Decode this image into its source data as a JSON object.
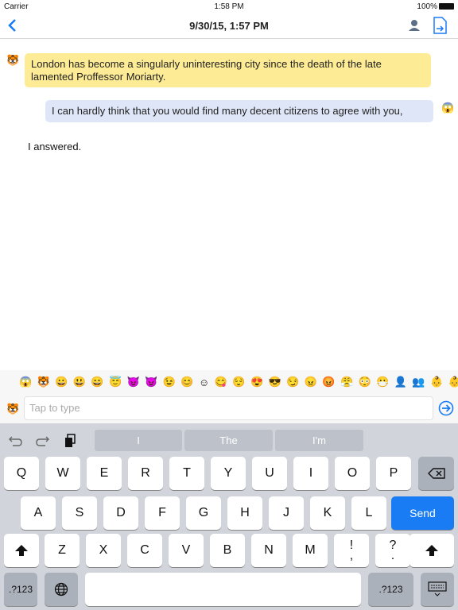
{
  "status": {
    "carrier": "Carrier",
    "time": "1:58 PM",
    "battery": "100%"
  },
  "nav": {
    "title": "9/30/15, 1:57 PM",
    "back_icon": "chevron-left",
    "icons": [
      "person-icon",
      "copy-document-icon"
    ]
  },
  "messages": [
    {
      "avatar": "🐯",
      "text": "London has become a singularly uninteresting city since the death of the late lamented Proffessor Moriarty."
    },
    {
      "avatar": "😱",
      "text": "I can hardly think that you would find many decent citizens to agree with you,"
    },
    {
      "text": "I answered."
    }
  ],
  "emoji_bar": [
    "😱",
    "🐯",
    "😀",
    "😃",
    "😄",
    "😇",
    "😈",
    "👿",
    "😉",
    "😊",
    "☺",
    "😋",
    "😌",
    "😍",
    "😎",
    "😏",
    "😠",
    "😡",
    "😤",
    "😳",
    "😷",
    "👤",
    "👥",
    "👶",
    "👶"
  ],
  "input": {
    "avatar": "🐯",
    "placeholder": "Tap to type"
  },
  "suggestions": [
    "I",
    "The",
    "I'm"
  ],
  "keyboard": {
    "row1": [
      "Q",
      "W",
      "E",
      "R",
      "T",
      "Y",
      "U",
      "I",
      "O",
      "P"
    ],
    "row2": [
      "A",
      "S",
      "D",
      "F",
      "G",
      "H",
      "J",
      "K",
      "L"
    ],
    "row3": [
      "Z",
      "X",
      "C",
      "V",
      "B",
      "N",
      "M",
      "!\n,",
      "?\n."
    ],
    "send": "Send",
    "numbers": ".?123"
  },
  "colors": {
    "accent": "#1a7cf5",
    "incoming": "#fdeb95",
    "outgoing": "#dfe6f7"
  }
}
